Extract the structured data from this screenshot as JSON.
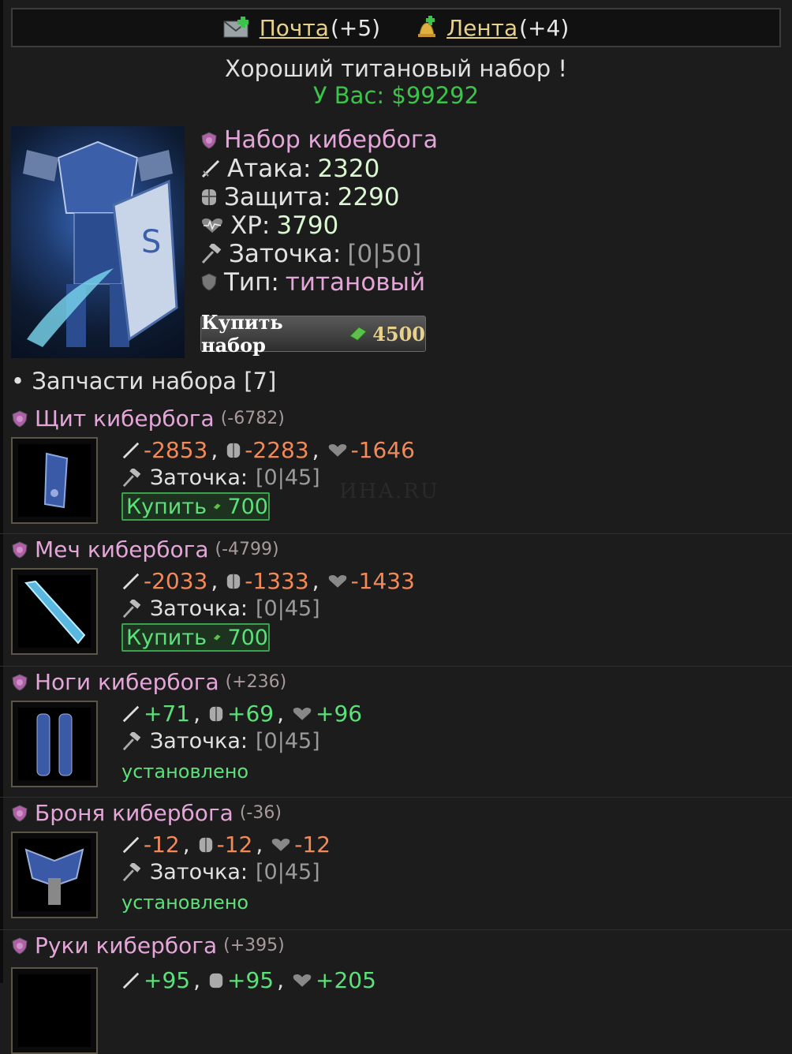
{
  "topbar": {
    "mail_label": "Почта",
    "mail_count": "(+5)",
    "feed_label": "Лента",
    "feed_count": "(+4)"
  },
  "headline": "Хороший титановый набор !",
  "money": "У Вас: $99292",
  "set": {
    "name": "Набор кибербога",
    "attack_label": "Атака:",
    "attack": "2320",
    "defense_label": "Защита:",
    "defense": "2290",
    "hp_label": "ХР:",
    "hp": "3790",
    "sharpen_label": "Заточка:",
    "sharpen": "[0|50]",
    "type_label": "Тип:",
    "type": "титановый",
    "buy_label": "Купить набор",
    "buy_price": "4500"
  },
  "parts_header": "• Запчасти набора [7]",
  "items": [
    {
      "name": "Щит кибербога",
      "diff": "(-6782)",
      "atk": "-2853",
      "def": "-2283",
      "hp": "-1646",
      "sharpen_label": "Заточка:",
      "sharpen": "[0|45]",
      "status": "buy",
      "buy_label": "Купить",
      "price": "700"
    },
    {
      "name": "Меч кибербога",
      "diff": "(-4799)",
      "atk": "-2033",
      "def": "-1333",
      "hp": "-1433",
      "sharpen_label": "Заточка:",
      "sharpen": "[0|45]",
      "status": "buy",
      "buy_label": "Купить",
      "price": "700"
    },
    {
      "name": "Ноги кибербога",
      "diff": "(+236)",
      "atk": "+71",
      "def": "+69",
      "hp": "+96",
      "sharpen_label": "Заточка:",
      "sharpen": "[0|45]",
      "status": "installed",
      "installed_label": "установлено"
    },
    {
      "name": "Броня кибербога",
      "diff": "(-36)",
      "atk": "-12",
      "def": "-12",
      "hp": "-12",
      "sharpen_label": "Заточка:",
      "sharpen": "[0|45]",
      "status": "installed",
      "installed_label": "установлено"
    },
    {
      "name": "Руки кибербога",
      "diff": "(+395)",
      "atk": "+95",
      "def": "+95",
      "hp": "+205"
    }
  ],
  "watermark": "ИНА.RU",
  "icons": {
    "mail": "mail-icon",
    "feed": "bell-icon",
    "shield": "shield-badge-icon",
    "sword": "sword-icon",
    "armor": "armor-icon",
    "heart": "heartbeat-icon",
    "hammer": "hammer-icon",
    "money": "cash-icon"
  },
  "colors": {
    "accent_pink": "#e4a6d8",
    "money_green": "#3bc44a",
    "positive": "#5ce07a",
    "negative": "#f08a5a",
    "link_gold": "#e8d18a"
  }
}
